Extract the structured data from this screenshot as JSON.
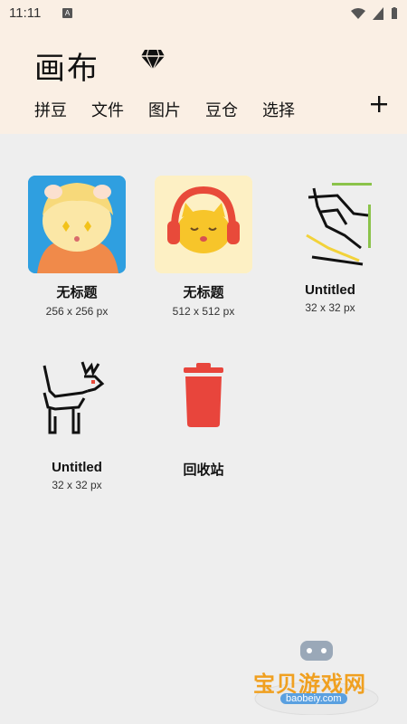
{
  "status": {
    "time": "11:11",
    "a_badge": "A"
  },
  "header": {
    "title": "画布",
    "tabs": [
      "拼豆",
      "文件",
      "图片",
      "豆仓",
      "选择"
    ]
  },
  "items": [
    {
      "name": "无标题",
      "size": "256 x 256 px"
    },
    {
      "name": "无标题",
      "size": "512 x 512 px"
    },
    {
      "name": "Untitled",
      "size": "32 x 32 px"
    },
    {
      "name": "Untitled",
      "size": "32 x 32 px"
    },
    {
      "name": "回收站",
      "size": ""
    }
  ],
  "watermark": {
    "text": "宝贝游戏网",
    "url": "baobeiy.com"
  },
  "colors": {
    "header_bg": "#faefe4",
    "body_bg": "#eeeeee",
    "trash": "#e8453c"
  },
  "icons": [
    "diamond-icon",
    "plus-icon",
    "trash-icon",
    "wifi-icon",
    "signal-icon",
    "battery-icon"
  ]
}
